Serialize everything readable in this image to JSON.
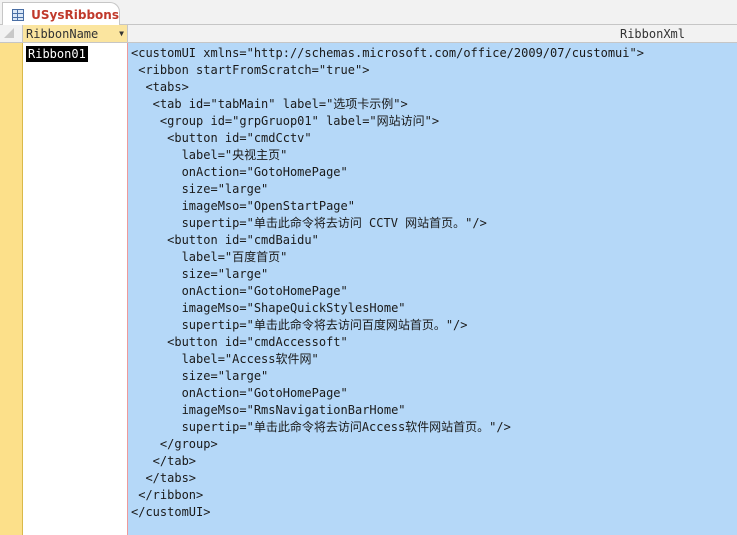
{
  "tab": {
    "icon": "table-icon",
    "title": "USysRibbons"
  },
  "columns": {
    "ribbon_name": "RibbonName",
    "ribbon_xml": "RibbonXml"
  },
  "record": {
    "ribbon_name": "Ribbon01",
    "xml_lines": [
      "<customUI xmlns=\"http://schemas.microsoft.com/office/2009/07/customui\">",
      " <ribbon startFromScratch=\"true\">",
      "  <tabs>",
      "   <tab id=\"tabMain\" label=\"选项卡示例\">",
      "    <group id=\"grpGruop01\" label=\"网站访问\">",
      "     <button id=\"cmdCctv\"",
      "       label=\"央视主页\"",
      "       onAction=\"GotoHomePage\"",
      "       size=\"large\"",
      "       imageMso=\"OpenStartPage\"",
      "       supertip=\"单击此命令将去访问 CCTV 网站首页。\"/>",
      "     <button id=\"cmdBaidu\"",
      "       label=\"百度首页\"",
      "       size=\"large\"",
      "       onAction=\"GotoHomePage\"",
      "       imageMso=\"ShapeQuickStylesHome\"",
      "       supertip=\"单击此命令将去访问百度网站首页。\"/>",
      "     <button id=\"cmdAccessoft\"",
      "       label=\"Access软件网\"",
      "       size=\"large\"",
      "       onAction=\"GotoHomePage\"",
      "       imageMso=\"RmsNavigationBarHome\"",
      "       supertip=\"单击此命令将去访问Access软件网站首页。\"/>",
      "    </group>",
      "   </tab>",
      "  </tabs>",
      " </ribbon>",
      "</customUI>"
    ]
  }
}
